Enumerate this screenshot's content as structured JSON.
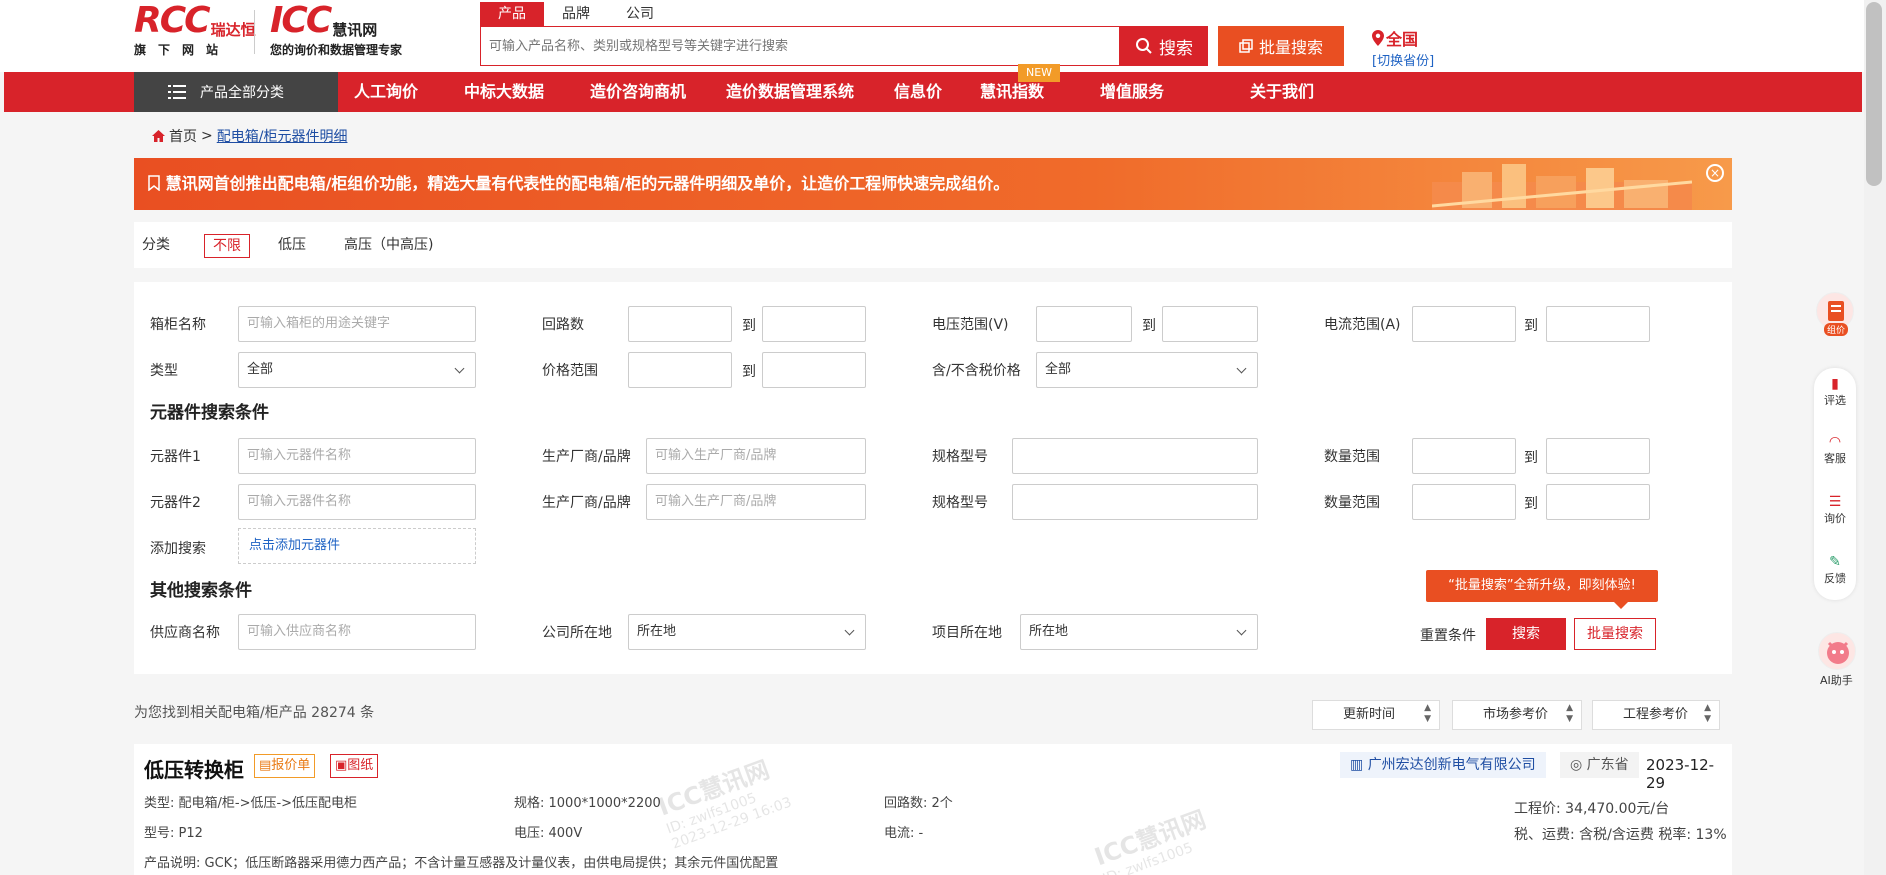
{
  "header": {
    "logo1": {
      "big": "RCC",
      "cn": "瑞达恒",
      "sub": "旗下网站"
    },
    "logo2": {
      "big": "ICC",
      "cn": "慧讯网",
      "sub": "您的询价和数据管理专家"
    },
    "search_tabs": [
      "产品",
      "品牌",
      "公司"
    ],
    "search_placeholder": "可输入产品名称、类别或规格型号等关键字进行搜索",
    "search_button": "搜索",
    "batch_button": "批量搜索",
    "location": {
      "name": "全国",
      "switch": "[切换省份]"
    }
  },
  "nav": {
    "category": "产品全部分类",
    "items": [
      "人工询价",
      "中标大数据",
      "造价咨询商机",
      "造价数据管理系统",
      "信息价",
      "慧讯指数",
      "增值服务",
      "关于我们"
    ],
    "new_badge": "NEW"
  },
  "breadcrumb": {
    "home": "首页",
    "current": "配电箱/柜元器件明细"
  },
  "banner": {
    "text": "慧讯网首创推出配电箱/柜组价功能，精选大量有代表性的配电箱/柜的元器件明细及单价，让造价工程师快速完成组价。",
    "close": "×"
  },
  "category_row": {
    "label": "分类",
    "options": [
      "不限",
      "低压",
      "高压（中高压)"
    ]
  },
  "form": {
    "cabinet_name": {
      "label": "箱柜名称",
      "placeholder": "可输入箱柜的用途关键字"
    },
    "loops": {
      "label": "回路数"
    },
    "voltage": {
      "label": "电压范围(V)"
    },
    "current": {
      "label": "电流范围(A)"
    },
    "to": "到",
    "type": {
      "label": "类型",
      "value": "全部"
    },
    "price": {
      "label": "价格范围"
    },
    "tax": {
      "label": "含/不含税价格",
      "value": "全部"
    },
    "component_section": "元器件搜索条件",
    "component1": {
      "label": "元器件1",
      "placeholder": "可输入元器件名称"
    },
    "component2": {
      "label": "元器件2",
      "placeholder": "可输入元器件名称"
    },
    "maker": {
      "label": "生产厂商/品牌",
      "placeholder": "可输入生产厂商/品牌"
    },
    "spec": {
      "label": "规格型号"
    },
    "qty": {
      "label": "数量范围"
    },
    "add": {
      "label": "添加搜索",
      "link": "点击添加元器件"
    },
    "other_section": "其他搜索条件",
    "supplier": {
      "label": "供应商名称",
      "placeholder": "可输入供应商名称"
    },
    "company_loc": {
      "label": "公司所在地",
      "value": "所在地"
    },
    "project_loc": {
      "label": "项目所在地",
      "value": "所在地"
    },
    "reset": "重置条件",
    "search": "搜索",
    "batch": "批量搜索",
    "tip": "“批量搜索”全新升级，即刻体验!"
  },
  "results": {
    "count_text": "为您找到相关配电箱/柜产品 28274 条",
    "sorts": [
      "更新时间",
      "市场参考价",
      "工程参考价"
    ]
  },
  "card": {
    "title": "低压转换柜",
    "tag_quote": "报价单",
    "tag_drawing": "图纸",
    "company": "广州宏达创新电气有限公司",
    "province": "广东省",
    "date": "2023-12-29",
    "category": "类型: 配电箱/柜->低压->低压配电柜",
    "spec": "规格: 1000*1000*2200",
    "loops": "回路数: 2个",
    "model": "型号: P12",
    "voltage": "电压: 400V",
    "current": "电流: -",
    "desc": "产品说明: GCK；低压断路器采用德力西产品；不含计量互感器及计量仪表，由供电局提供；其余元件国优配置",
    "eng_price": "工程价: 34,470.00元/台",
    "tax_info": "税、运费: 含税/含运费 税率: 13%",
    "watermark": "ICC慧讯网",
    "watermark_id": "ID: zwlfs1005",
    "watermark_time": "2023-12-29 16:03"
  },
  "sidebar": {
    "quote": "组价",
    "items": [
      "评选",
      "客服",
      "询价",
      "反馈"
    ],
    "ai": "AI助手"
  },
  "colors": {
    "brand": "#d8232a",
    "orange": "#e94f22",
    "link": "#1f63c4"
  }
}
